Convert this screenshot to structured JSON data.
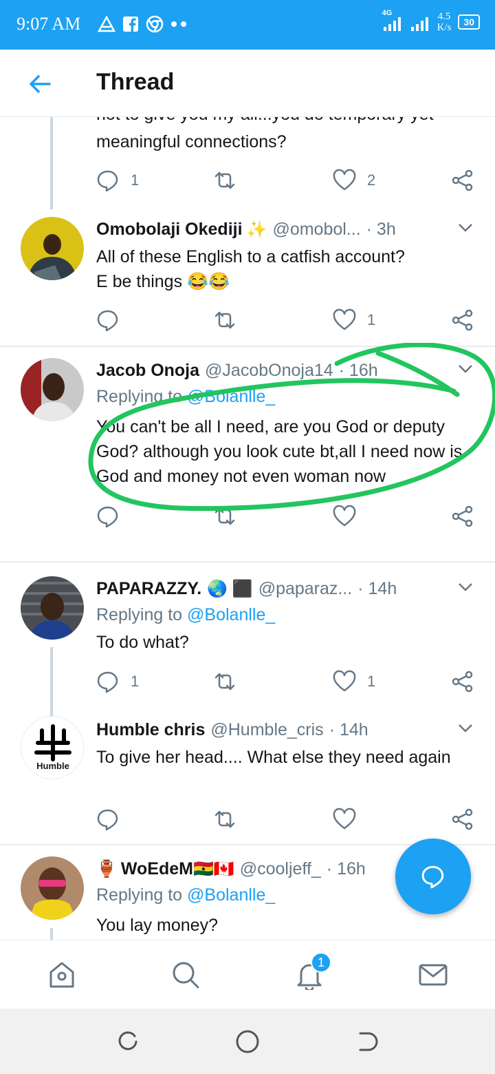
{
  "status_bar": {
    "time": "9:07 AM",
    "network": "4G",
    "speed_value": "4.5",
    "speed_unit": "K/s",
    "battery": "30"
  },
  "header": {
    "title": "Thread"
  },
  "tweets": [
    {
      "text_cut": "not to give you my all...you do temporary yet",
      "text": "meaningful connections?",
      "reply_count": "1",
      "like_count": "2"
    },
    {
      "name": "Omobolaji Okediji",
      "emoji": "✨",
      "handle": "@omobol...",
      "time": "· 3h",
      "text_line1": "All of these English to a catfish account?",
      "text_line2": "E be things",
      "text_emoji": "😂😂",
      "reply_count": "",
      "like_count": "1"
    },
    {
      "name": "Jacob Onoja",
      "handle": "@JacobOnoja14",
      "time": "· 16h",
      "replying": "Replying to",
      "reply_to": "@Bolanlle_",
      "text": "You can't be all I need, are you God or deputy God? although you look cute bt,all I need now is God and money not even woman now",
      "reply_count": "",
      "like_count": ""
    },
    {
      "name": "PAPARAZZY.",
      "emoji": "🌏 ⬛",
      "handle": "@paparaz...",
      "time": "· 14h",
      "replying": "Replying to",
      "reply_to": "@Bolanlle_",
      "text": "To do what?",
      "reply_count": "1",
      "like_count": "1"
    },
    {
      "name": "Humble chris",
      "handle": "@Humble_cris",
      "time": "· 14h",
      "avatar_label": "Humble",
      "text": "To give her head.... What else they need again",
      "reply_count": "",
      "like_count": ""
    },
    {
      "name": "WoEdeM",
      "name_prefix": "🏺",
      "flags": "🇬🇭🇨🇦",
      "handle": "@cooljeff_",
      "time": "· 16h",
      "replying": "Replying to",
      "reply_to": "@Bolanlle_",
      "text": "You lay money?"
    }
  ],
  "bottom_nav": {
    "notification_badge": "1"
  },
  "colors": {
    "accent": "#1da1f2",
    "annotation": "#22c55e",
    "text": "#14171a",
    "muted": "#657786"
  }
}
